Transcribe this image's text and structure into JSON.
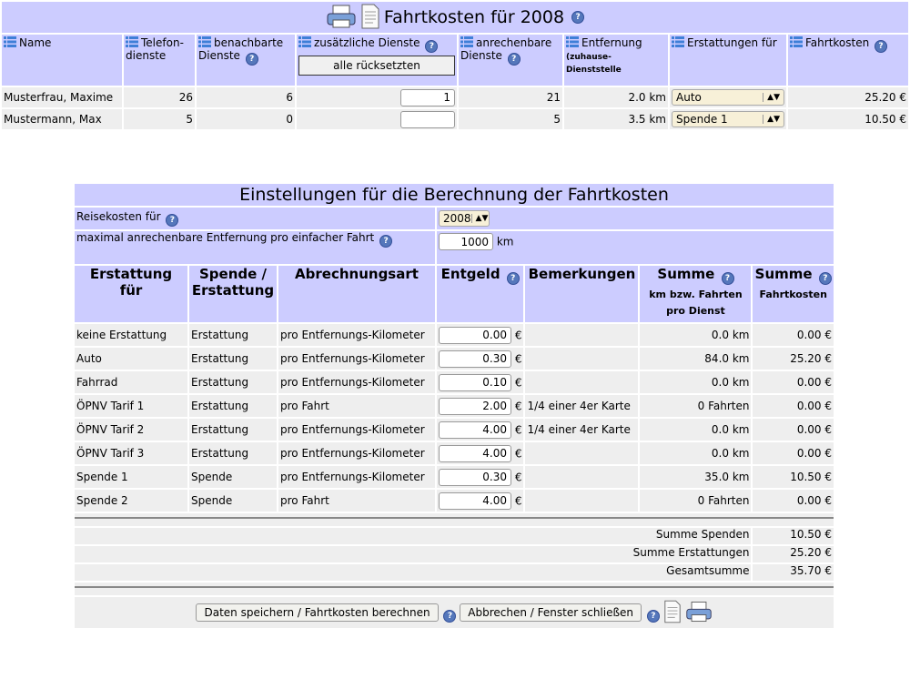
{
  "top": {
    "title": "Fahrtkosten für 2008",
    "columns": {
      "name": "Name",
      "telefon": "Telefon-dienste",
      "benachbarte": "benachbarte Dienste",
      "zusaetzliche": "zusätzliche Dienste",
      "reset_label": "alle rücksetzten",
      "anrechenbare": "anrechenbare Dienste",
      "entfernung": "Entfernung",
      "entfernung_sub": "(zuhause-Dienststelle",
      "erstattungen": "Erstattungen für",
      "fahrtkosten": "Fahrtkosten"
    },
    "rows": [
      {
        "name": "Musterfrau, Maxime",
        "telefon": "26",
        "benachbarte": "6",
        "zusaetzliche": "1",
        "anrechenbare": "21",
        "entfernung": "2.0 km",
        "erstattung": "Auto",
        "fahrtkosten": "25.20 €"
      },
      {
        "name": "Mustermann, Max",
        "telefon": "5",
        "benachbarte": "0",
        "zusaetzliche": "",
        "anrechenbare": "5",
        "entfernung": "3.5 km",
        "erstattung": "Spende 1",
        "fahrtkosten": "10.50 €"
      }
    ]
  },
  "settings": {
    "title": "Einstellungen für die Berechnung der Fahrtkosten",
    "reisekosten_label": "Reisekosten für",
    "reisekosten_year": "2008",
    "max_entfernung_label": "maximal anrechenbare Entfernung pro einfacher Fahrt",
    "max_entfernung_value": "1000",
    "max_entfernung_unit": "km",
    "headers": {
      "erstattung": "Erstattung für",
      "spende": "Spende / Erstattung",
      "abrechnungsart": "Abrechnungsart",
      "entgeld": "Entgeld",
      "bemerkungen": "Bemerkungen",
      "summe1": "Summe",
      "summe1_sub": "km bzw. Fahrten pro Dienst",
      "summe2": "Summe",
      "summe2_sub": "Fahrtkosten"
    },
    "euro": "€",
    "rows": [
      {
        "name": "keine Erstattung",
        "typ": "Erstattung",
        "art": "pro Entfernungs-Kilometer",
        "entgeld": "0.00",
        "bem": "",
        "summe": "0.0 km",
        "kosten": "0.00 €"
      },
      {
        "name": "Auto",
        "typ": "Erstattung",
        "art": "pro Entfernungs-Kilometer",
        "entgeld": "0.30",
        "bem": "",
        "summe": "84.0 km",
        "kosten": "25.20 €"
      },
      {
        "name": "Fahrrad",
        "typ": "Erstattung",
        "art": "pro Entfernungs-Kilometer",
        "entgeld": "0.10",
        "bem": "",
        "summe": "0.0 km",
        "kosten": "0.00 €"
      },
      {
        "name": "ÖPNV Tarif 1",
        "typ": "Erstattung",
        "art": "pro Fahrt",
        "entgeld": "2.00",
        "bem": "1/4 einer 4er Karte",
        "summe": "0 Fahrten",
        "kosten": "0.00 €"
      },
      {
        "name": "ÖPNV Tarif 2",
        "typ": "Erstattung",
        "art": "pro Entfernungs-Kilometer",
        "entgeld": "4.00",
        "bem": "1/4 einer 4er Karte",
        "summe": "0.0 km",
        "kosten": "0.00 €"
      },
      {
        "name": "ÖPNV Tarif 3",
        "typ": "Erstattung",
        "art": "pro Entfernungs-Kilometer",
        "entgeld": "4.00",
        "bem": "",
        "summe": "0.0 km",
        "kosten": "0.00 €"
      },
      {
        "name": "Spende 1",
        "typ": "Spende",
        "art": "pro Entfernungs-Kilometer",
        "entgeld": "0.30",
        "bem": "",
        "summe": "35.0 km",
        "kosten": "10.50 €"
      },
      {
        "name": "Spende 2",
        "typ": "Spende",
        "art": "pro Fahrt",
        "entgeld": "4.00",
        "bem": "",
        "summe": "0 Fahrten",
        "kosten": "0.00 €"
      }
    ],
    "totals": [
      {
        "label": "Summe Spenden",
        "value": "10.50 €"
      },
      {
        "label": "Summe Erstattungen",
        "value": "25.20 €"
      },
      {
        "label": "Gesamtsumme",
        "value": "35.70 €"
      }
    ],
    "save_label": "Daten speichern / Fahrtkosten berechnen",
    "cancel_label": "Abbrechen / Fenster schließen"
  },
  "colors": {
    "header_bg": "#ccccff",
    "row_bg": "#eeeeee",
    "help_icon": "#5577bb"
  },
  "icons": [
    "printer-icon",
    "document-icon",
    "help-icon",
    "sort-list-icon",
    "select-arrows-icon"
  ]
}
